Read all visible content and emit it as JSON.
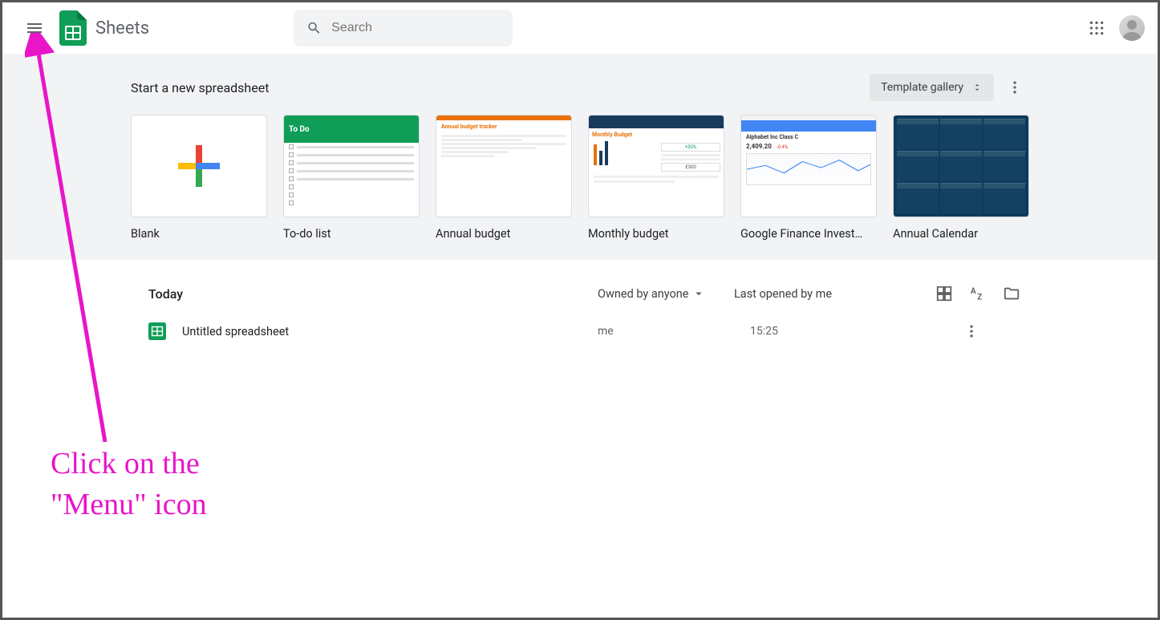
{
  "header": {
    "app_name": "Sheets",
    "search_placeholder": "Search"
  },
  "templates": {
    "title": "Start a new spreadsheet",
    "gallery_label": "Template gallery",
    "items": [
      {
        "label": "Blank"
      },
      {
        "label": "To-do list"
      },
      {
        "label": "Annual budget"
      },
      {
        "label": "Monthly budget"
      },
      {
        "label": "Google Finance Invest…"
      },
      {
        "label": "Annual Calendar"
      }
    ],
    "todo_head": "To Do",
    "annual_head": "Annual budget tracker",
    "monthly_head": "Monthly Budget",
    "finance_name": "Alphabet Inc Class C",
    "finance_price": "2,409.20"
  },
  "docs": {
    "group_label": "Today",
    "owned_filter": "Owned by anyone",
    "sort_label": "Last opened by me",
    "rows": [
      {
        "name": "Untitled spreadsheet",
        "owner": "me",
        "time": "15:25"
      }
    ]
  },
  "annotation": {
    "line1": "Click on the",
    "line2": "\"Menu\" icon"
  }
}
